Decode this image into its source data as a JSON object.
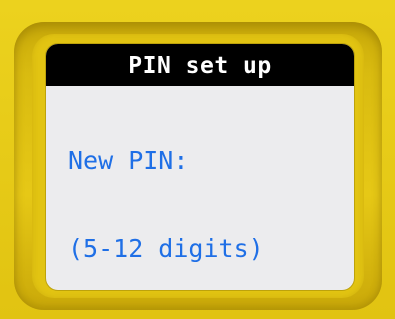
{
  "screen": {
    "title": "PIN set up",
    "prompt": "New PIN:",
    "hint": "(5-12 digits)"
  },
  "colors": {
    "bezel": "#e3c515",
    "title_bar": "#000000",
    "title_text": "#ffffff",
    "screen_bg": "#ececee",
    "body_text": "#1f6fe6"
  }
}
